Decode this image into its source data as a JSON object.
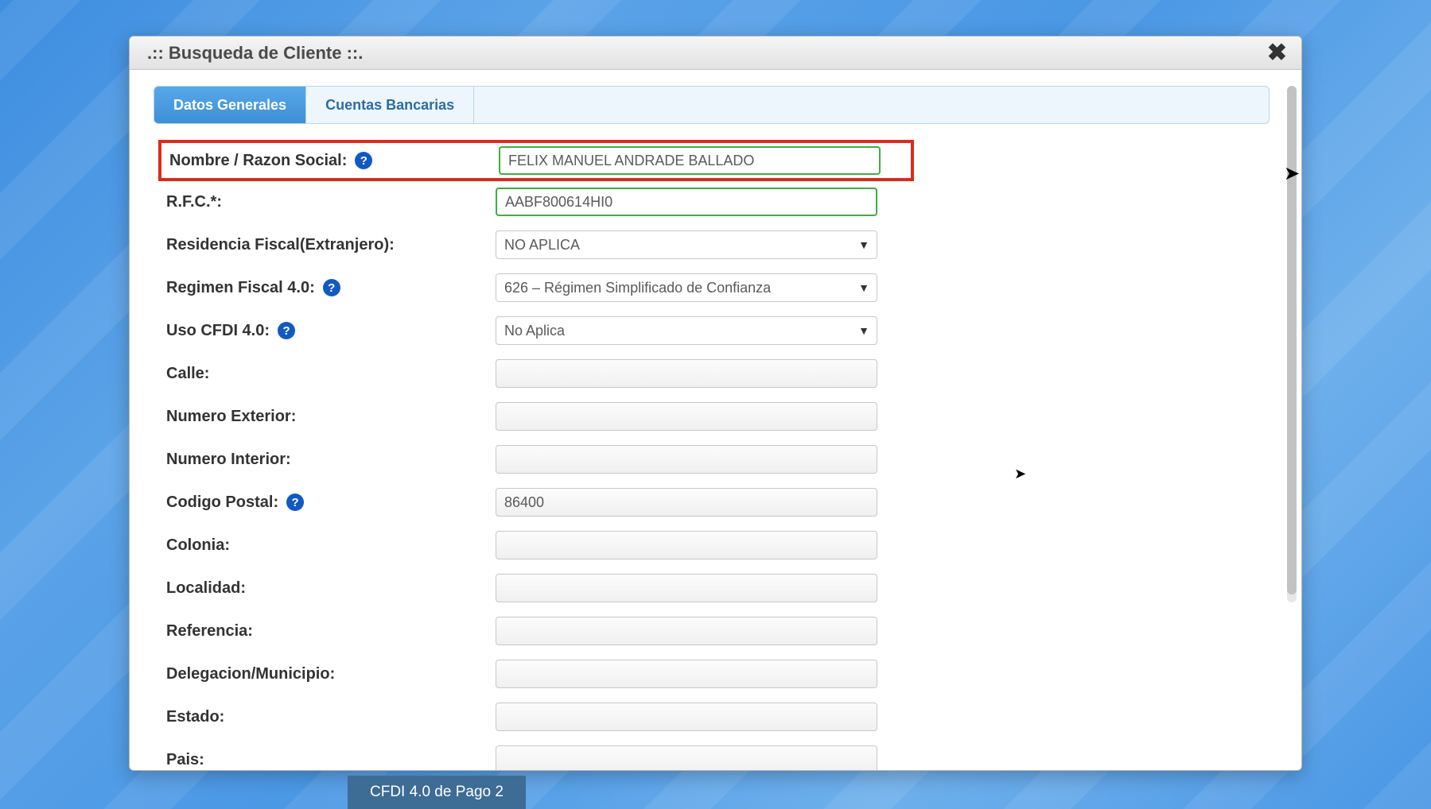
{
  "modal": {
    "title": ".:: Busqueda de Cliente ::."
  },
  "tabs": {
    "general": "Datos Generales",
    "bank": "Cuentas Bancarias"
  },
  "form": {
    "nombre": {
      "label": "Nombre / Razon Social:",
      "value": "FELIX MANUEL ANDRADE BALLADO"
    },
    "rfc": {
      "label": "R.F.C.*:",
      "value": "AABF800614HI0"
    },
    "residencia": {
      "label": "Residencia Fiscal(Extranjero):",
      "value": "NO APLICA"
    },
    "regimen": {
      "label": "Regimen Fiscal 4.0:",
      "value": "626 – Régimen Simplificado de Confianza"
    },
    "usocfdi": {
      "label": "Uso CFDI 4.0:",
      "value": "No Aplica"
    },
    "calle": {
      "label": "Calle:",
      "value": ""
    },
    "numext": {
      "label": "Numero Exterior:",
      "value": ""
    },
    "numint": {
      "label": "Numero Interior:",
      "value": ""
    },
    "cp": {
      "label": "Codigo Postal:",
      "value": "86400"
    },
    "colonia": {
      "label": "Colonia:",
      "value": ""
    },
    "localidad": {
      "label": "Localidad:",
      "value": ""
    },
    "referencia": {
      "label": "Referencia:",
      "value": ""
    },
    "delegacion": {
      "label": "Delegacion/Municipio:",
      "value": ""
    },
    "estado": {
      "label": "Estado:",
      "value": ""
    },
    "pais": {
      "label": "Pais:",
      "value": ""
    }
  },
  "footer": {
    "tab_label": "CFDI 4.0 de Pago 2"
  },
  "help_glyph": "?"
}
